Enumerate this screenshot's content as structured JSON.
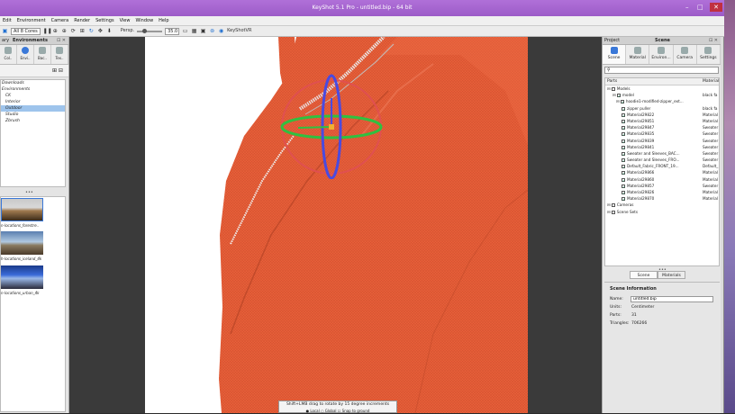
{
  "window": {
    "title": "KeyShot 5.1 Pro - untitled.bip - 64 bit"
  },
  "menu": [
    "Edit",
    "Environment",
    "Camera",
    "Render",
    "Settings",
    "View",
    "Window",
    "Help"
  ],
  "toolbar": {
    "cores": "All 8 Cores",
    "persp": "Persp.",
    "fov": "35.0",
    "keyshotvr": "KeyShotVR"
  },
  "left_panel": {
    "title": "Environments",
    "left_label": "ary",
    "tabs": [
      "Col..",
      "Envi..",
      "Bac..",
      "Tex.."
    ],
    "tree": [
      "Downloads",
      "Environments",
      "CK",
      "Interior",
      "Outdoor",
      "Studio",
      "Zbrush"
    ],
    "thumbnails": [
      "n-locations_forestre..",
      "h-locations_iceland_4k",
      "n-locations_urban_4k"
    ]
  },
  "hint": {
    "line1": "Shift+LMB drag to rotate by 15 degree increments",
    "local": "Local",
    "global": "Global",
    "snap": "Snap to ground"
  },
  "right_panel": {
    "project": "Project",
    "title": "Scene",
    "tabs": [
      "Scene",
      "Material",
      "Environ...",
      "Camera",
      "Settings"
    ],
    "search": "",
    "parts_header": "Parts",
    "material_header": "Material",
    "rows": [
      {
        "name": "Models",
        "mat": ""
      },
      {
        "name": "model",
        "mat": "black fa"
      },
      {
        "name": "hoodie1-modified-zipper_ext...",
        "mat": ""
      },
      {
        "name": "zipper puller",
        "mat": "black fa"
      },
      {
        "name": "Material29822",
        "mat": "Material"
      },
      {
        "name": "Material29851",
        "mat": "Material"
      },
      {
        "name": "Material29847",
        "mat": "Sweater"
      },
      {
        "name": "Material29835",
        "mat": "Sweater"
      },
      {
        "name": "Material29839",
        "mat": "Sweater"
      },
      {
        "name": "Material29841",
        "mat": "Sweater"
      },
      {
        "name": "Sweater and Sleeves_BAC...",
        "mat": "Sweater"
      },
      {
        "name": "Sweater and Sleeves_FRO...",
        "mat": "Sweater"
      },
      {
        "name": "Default_Fabric_FRONT_19...",
        "mat": "Default_"
      },
      {
        "name": "Material29866",
        "mat": "Material"
      },
      {
        "name": "Material29860",
        "mat": "Material"
      },
      {
        "name": "Material29857",
        "mat": "Sweater"
      },
      {
        "name": "Material29826",
        "mat": "Material"
      },
      {
        "name": "Material29870",
        "mat": "Material"
      },
      {
        "name": "Cameras",
        "mat": ""
      },
      {
        "name": "Scene Sets",
        "mat": ""
      }
    ],
    "bottom_tabs": [
      "Scene",
      "Materials"
    ],
    "info_title": "Scene Information",
    "info": {
      "name_label": "Name:",
      "name": "untitled.bip",
      "units_label": "Units:",
      "units": "Centimeter",
      "parts_label": "Parts:",
      "parts": "31",
      "tri_label": "Triangles:",
      "triangles": "706266"
    }
  },
  "colors": {
    "titlebar": "#a463d0",
    "fabric": "#e8603a",
    "gizmo_red": "#e05050",
    "gizmo_blue": "#4a4ae0",
    "gizmo_green": "#30c040"
  }
}
